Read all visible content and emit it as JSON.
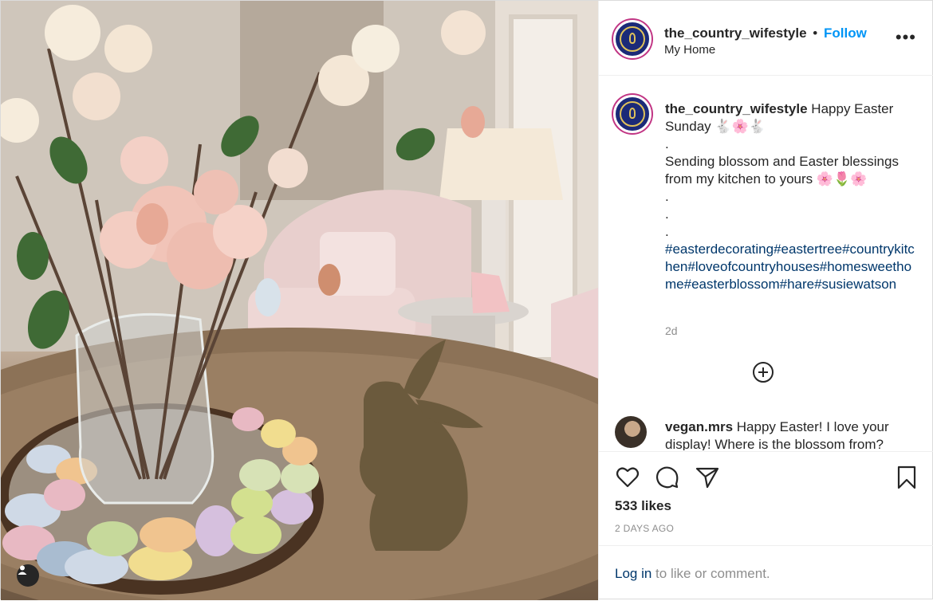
{
  "post": {
    "username": "the_country_wifestyle",
    "separator": "•",
    "follow_label": "Follow",
    "location": "My Home",
    "more_label": "•••"
  },
  "caption": {
    "username": "the_country_wifestyle",
    "text_line1": "Happy Easter Sunday 🐇🌸🐇",
    "dot1": ".",
    "text_line2": "Sending blossom and Easter blessings from my kitchen to yours 🌸🌷🌸",
    "dot2": ".",
    "dot3": ".",
    "dot4": ".",
    "hashtags": "#easterdecorating#eastertree#countrykitchen#loveofcountryhouses#homesweethome#easterblossom#hare#susiewatson",
    "age": "2d"
  },
  "comment": {
    "username": "vegan.mrs",
    "text": "Happy Easter! I love your display! Where is the blossom from?"
  },
  "actions": {
    "icons": [
      "heart-icon",
      "comment-icon",
      "share-icon",
      "bookmark-icon"
    ],
    "likes": "533 likes",
    "time_ago": "2 DAYS AGO"
  },
  "login": {
    "link_label": "Log in",
    "rest_label": " to like or comment."
  },
  "colors": {
    "accent_link": "#0095f6",
    "hashtag": "#00376b",
    "muted": "#8e8e8e",
    "text": "#262626"
  }
}
